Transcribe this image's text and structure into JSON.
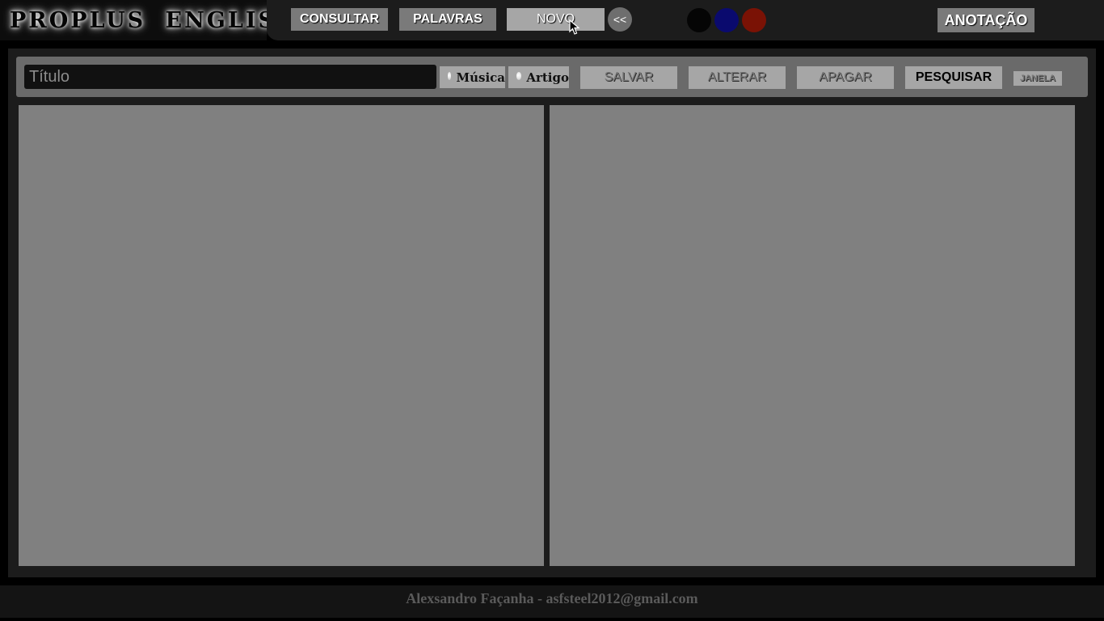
{
  "header": {
    "logo_text": "PROPLUS ENGLISH",
    "nav": {
      "consultar_label": "CONSULTAR",
      "palavras_label": "PALAVRAS",
      "novo_label": "NOVO",
      "back_label": "<<"
    },
    "color_swatches": [
      "#050505",
      "#0a0a6e",
      "#7a1205"
    ],
    "anotacao_label": "ANOTAÇÃO"
  },
  "toolbar": {
    "titulo_placeholder": "Título",
    "titulo_value": "",
    "radio_musica_label": "Música",
    "radio_artigo_label": "Artigo",
    "salvar_label": "SALVAR",
    "alterar_label": "ALTERAR",
    "apagar_label": "APAGAR",
    "pesquisar_label": "PESQUISAR",
    "janela_label": "JANELA"
  },
  "footer": {
    "credit": "Alexsandro Façanha - asfsteel2012@gmail.com"
  },
  "colors": {
    "pane_gray": "#808080",
    "panel_dark": "#1c1c1c",
    "button_gray": "#7a7a7a",
    "button_light": "#a6a6a6"
  }
}
